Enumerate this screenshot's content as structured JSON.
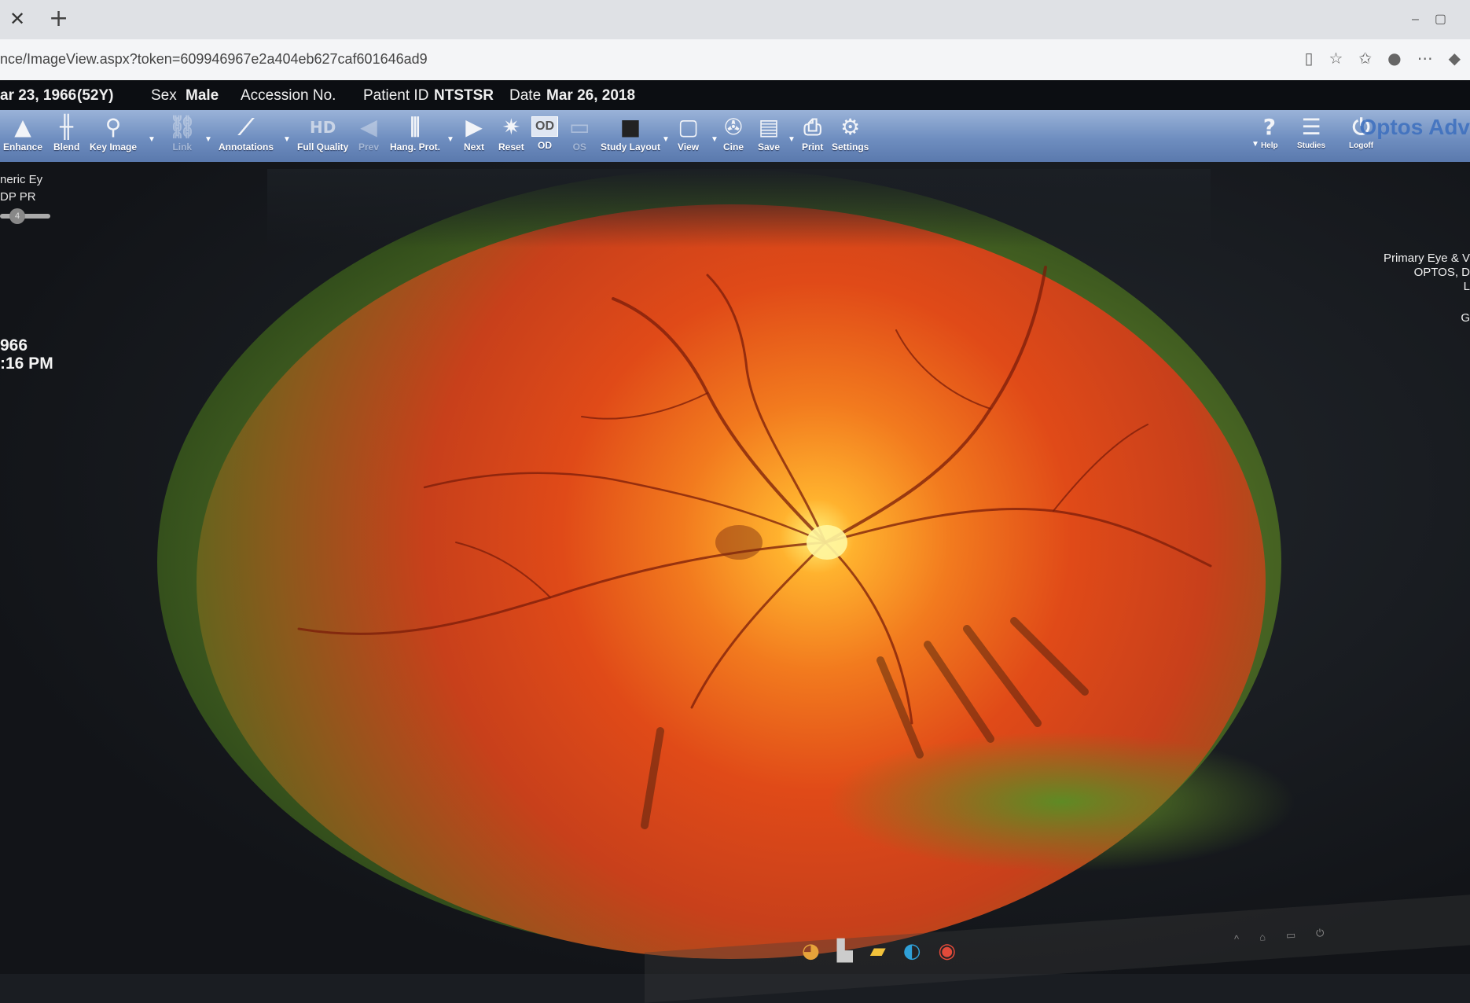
{
  "browser": {
    "tab_close": "✕",
    "tab_new": "+",
    "url": "nce/ImageView.aspx?token=609946967e2a404eb627caf601646ad9"
  },
  "patient": {
    "dob_label": "ar 23, 1966",
    "age": "(52Y)",
    "sex_label": "Sex",
    "sex_value": "Male",
    "accession_label": "Accession No.",
    "patient_id_label": "Patient ID",
    "patient_id_value": "NTSTSR",
    "date_label": "Date",
    "date_value": "Mar 26, 2018"
  },
  "toolbar": {
    "enhance": "Enhance",
    "blend": "Blend",
    "key_image": "Key Image",
    "link": "Link",
    "annotations": "Annotations",
    "hd_icon_text": "HD",
    "full_quality": "Full Quality",
    "prev": "Prev",
    "hang_prot": "Hang. Prot.",
    "next": "Next",
    "reset": "Reset",
    "od_box": "OD",
    "od": "OD",
    "os": "OS",
    "study_layout": "Study Layout",
    "view": "View",
    "cine": "Cine",
    "save": "Save",
    "print": "Print",
    "settings": "Settings",
    "help": "Help",
    "studies": "Studies",
    "logoff": "Logoff",
    "brand": "Optos Adv"
  },
  "overlay": {
    "top_left_line1": "neric Ey",
    "top_left_line2": "DP PR",
    "slider_value": "4",
    "date_partial": "966",
    "time_partial": ":16 PM",
    "right_line1": "Primary Eye & V",
    "right_line2": "OPTOS, D",
    "right_line3": "L",
    "right_line4": "G"
  },
  "colors": {
    "toolbar": "#6f8ec0",
    "patient_bar": "#0c0e12",
    "retina_center": "#fff27a",
    "retina_mid": "#e04a18"
  }
}
